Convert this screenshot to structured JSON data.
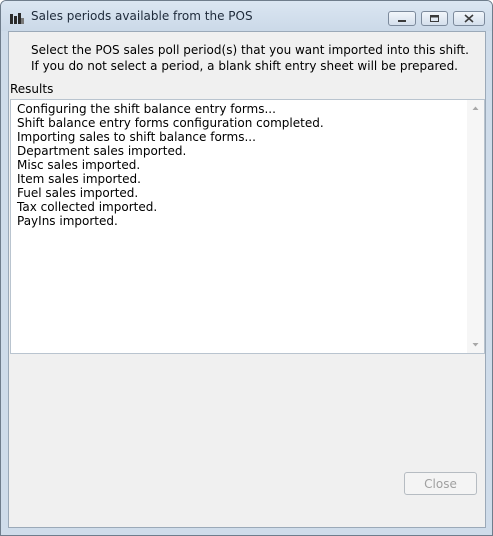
{
  "window": {
    "title": "Sales periods available from the POS"
  },
  "instructions": {
    "line1": "Select the POS sales poll period(s) that you want imported into this shift.",
    "line2": "If you do not select a period, a blank shift entry sheet will be prepared."
  },
  "results": {
    "label": "Results",
    "lines": [
      "Configuring the shift balance entry forms...",
      "Shift balance entry forms configuration completed.",
      "Importing sales to shift balance forms...",
      "Department sales imported.",
      "Misc sales imported.",
      "Item sales imported.",
      "Fuel sales imported.",
      "Tax collected imported.",
      "PayIns imported."
    ]
  },
  "buttons": {
    "close_label": "Close",
    "close_enabled": false
  }
}
